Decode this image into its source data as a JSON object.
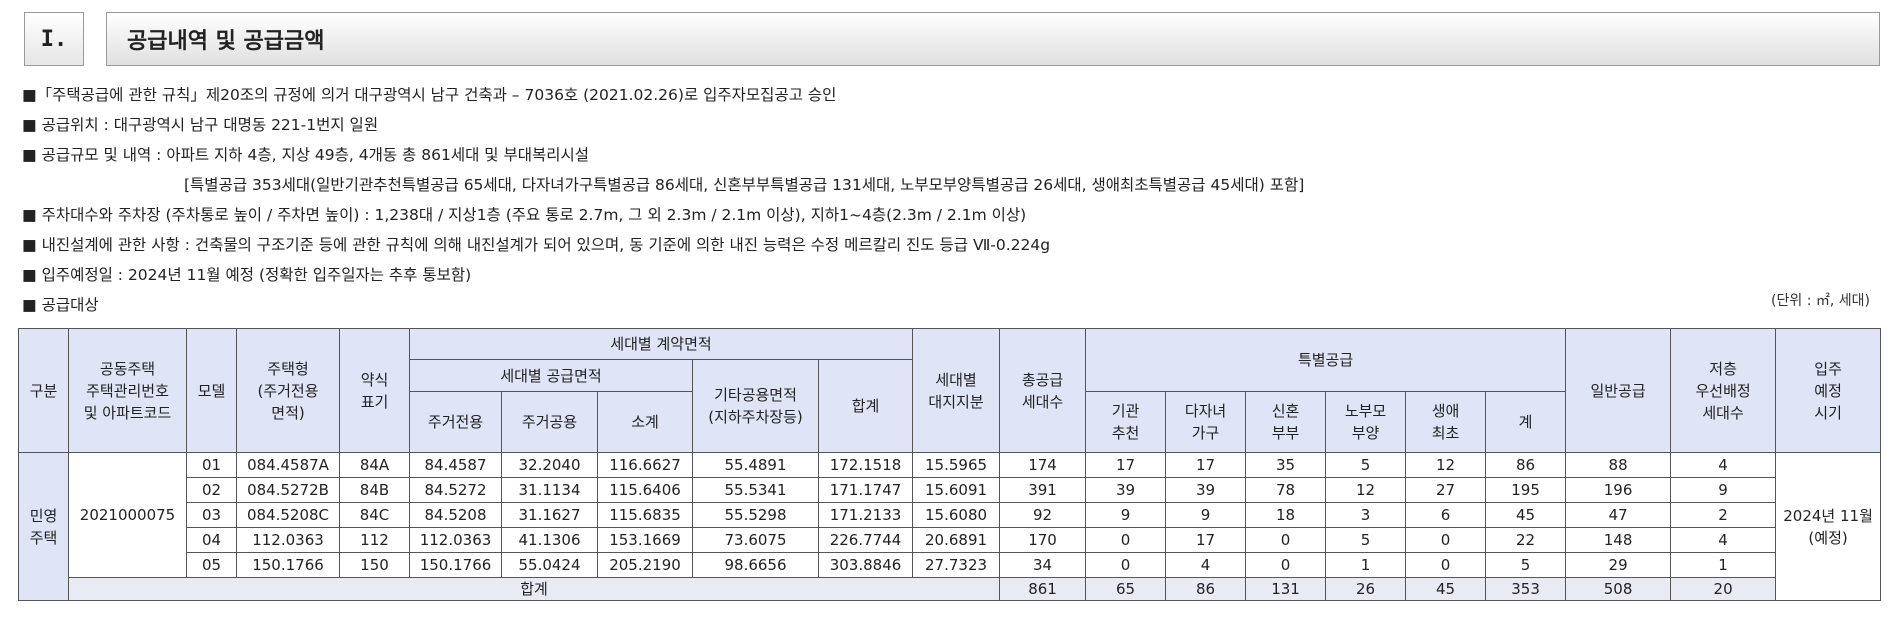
{
  "section": {
    "number": "I.",
    "title": "공급내역 및 공급금액"
  },
  "lines": [
    {
      "text": "■「주택공급에 관한 규칙」제20조의 규정에 의거 대구광역시 남구 건축과 – 7036호 (2021.02.26)로 입주자모집공고 승인"
    },
    {
      "text": "■  공급위치 : 대구광역시 남구 대명동 221-1번지 일원"
    },
    {
      "text": "■  공급규모 및 내역 : 아파트 지하 4층, 지상 49층, 4개동 총 861세대 및 부대복리시설"
    },
    {
      "text": "[특별공급 353세대(일반기관추천특별공급 65세대, 다자녀가구특별공급 86세대, 신혼부부특별공급 131세대, 노부모부양특별공급 26세대, 생애최초특별공급 45세대) 포함]"
    },
    {
      "text": "■  주차대수와 주차장 (주차통로 높이 / 주차면 높이) : 1,238대 / 지상1층 (주요 통로 2.7m,  그 외 2.3m   / 2.1m 이상), 지하1~4층(2.3m  / 2.1m 이상)"
    },
    {
      "text": "■  내진설계에 관한 사항 : 건축물의 구조기준 등에 관한 규칙에 의해 내진설계가 되어 있으며, 동 기준에 의한 내진 능력은 수정 메르칼리 진도 등급 Ⅶ-0.224g"
    },
    {
      "text": "■  입주예정일 : 2024년 11월 예정 (정확한 입주일자는 추후 통보함)"
    },
    {
      "text": "■  공급대상"
    }
  ],
  "unit": "(단위 : ㎡, 세대)",
  "table": {
    "headers": {
      "gubun": "구분",
      "code": "공동주택\n주택관리번호\n및 아파트코드",
      "model": "모델",
      "type": "주택형\n(주거전용\n면적)",
      "abbr": "약식\n표기",
      "contract_area": "세대별 계약면적",
      "supply_area": "세대별 공급면적",
      "excl": "주거전용",
      "common": "주거공용",
      "subtotal": "소계",
      "other_common": "기타공용면적\n(지하주차장등)",
      "total": "합계",
      "land": "세대별\n대지지분",
      "total_supply": "총공급\n세대수",
      "special": "특별공급",
      "inst": "기관\n추천",
      "multi": "다자녀\n가구",
      "newlywed": "신혼\n부부",
      "elderly": "노부모\n부양",
      "first": "생애\n최초",
      "special_sum": "계",
      "general": "일반공급",
      "low_floor": "저층\n우선배정\n세대수",
      "move_in": "입주\n예정\n시기"
    },
    "group_label": "민영\n주택",
    "housing_code": "2021000075",
    "move_in_value": "2024년 11월\n(예정)",
    "rows": [
      {
        "model": "01",
        "type": "084.4587A",
        "abbr": "84A",
        "excl": "84.4587",
        "common": "32.2040",
        "subtotal": "116.6627",
        "other": "55.4891",
        "total": "172.1518",
        "land": "15.5965",
        "supply": "174",
        "inst": "17",
        "multi": "17",
        "newlywed": "35",
        "elderly": "5",
        "first": "12",
        "special_sum": "86",
        "general": "88",
        "low": "4"
      },
      {
        "model": "02",
        "type": "084.5272B",
        "abbr": "84B",
        "excl": "84.5272",
        "common": "31.1134",
        "subtotal": "115.6406",
        "other": "55.5341",
        "total": "171.1747",
        "land": "15.6091",
        "supply": "391",
        "inst": "39",
        "multi": "39",
        "newlywed": "78",
        "elderly": "12",
        "first": "27",
        "special_sum": "195",
        "general": "196",
        "low": "9"
      },
      {
        "model": "03",
        "type": "084.5208C",
        "abbr": "84C",
        "excl": "84.5208",
        "common": "31.1627",
        "subtotal": "115.6835",
        "other": "55.5298",
        "total": "171.2133",
        "land": "15.6080",
        "supply": "92",
        "inst": "9",
        "multi": "9",
        "newlywed": "18",
        "elderly": "3",
        "first": "6",
        "special_sum": "45",
        "general": "47",
        "low": "2"
      },
      {
        "model": "04",
        "type": "112.0363",
        "abbr": "112",
        "excl": "112.0363",
        "common": "41.1306",
        "subtotal": "153.1669",
        "other": "73.6075",
        "total": "226.7744",
        "land": "20.6891",
        "supply": "170",
        "inst": "0",
        "multi": "17",
        "newlywed": "0",
        "elderly": "5",
        "first": "0",
        "special_sum": "22",
        "general": "148",
        "low": "4"
      },
      {
        "model": "05",
        "type": "150.1766",
        "abbr": "150",
        "excl": "150.1766",
        "common": "55.0424",
        "subtotal": "205.2190",
        "other": "98.6656",
        "total": "303.8846",
        "land": "27.7323",
        "supply": "34",
        "inst": "0",
        "multi": "4",
        "newlywed": "0",
        "elderly": "1",
        "first": "0",
        "special_sum": "5",
        "general": "29",
        "low": "1"
      }
    ],
    "sum": {
      "label": "합계",
      "supply": "861",
      "inst": "65",
      "multi": "86",
      "newlywed": "131",
      "elderly": "26",
      "first": "45",
      "special_sum": "353",
      "general": "508",
      "low": "20"
    }
  }
}
